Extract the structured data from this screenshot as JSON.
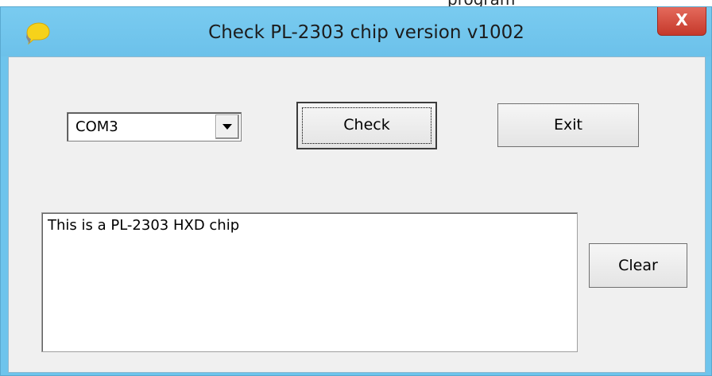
{
  "background_fragment": "program",
  "window": {
    "title": "Check PL-2303 chip version v1002",
    "app_icon": "yellow-speech-bubble-icon",
    "close_glyph": "X"
  },
  "port_select": {
    "selected": "COM3",
    "arrow_icon": "dropdown-arrow-icon"
  },
  "buttons": {
    "check": "Check",
    "exit": "Exit",
    "clear": "Clear"
  },
  "output": {
    "text": "This is a PL-2303 HXD chip"
  },
  "colors": {
    "titlebar": "#6ec4ec",
    "close_button": "#c7402f",
    "client_bg": "#f0f0f0"
  }
}
